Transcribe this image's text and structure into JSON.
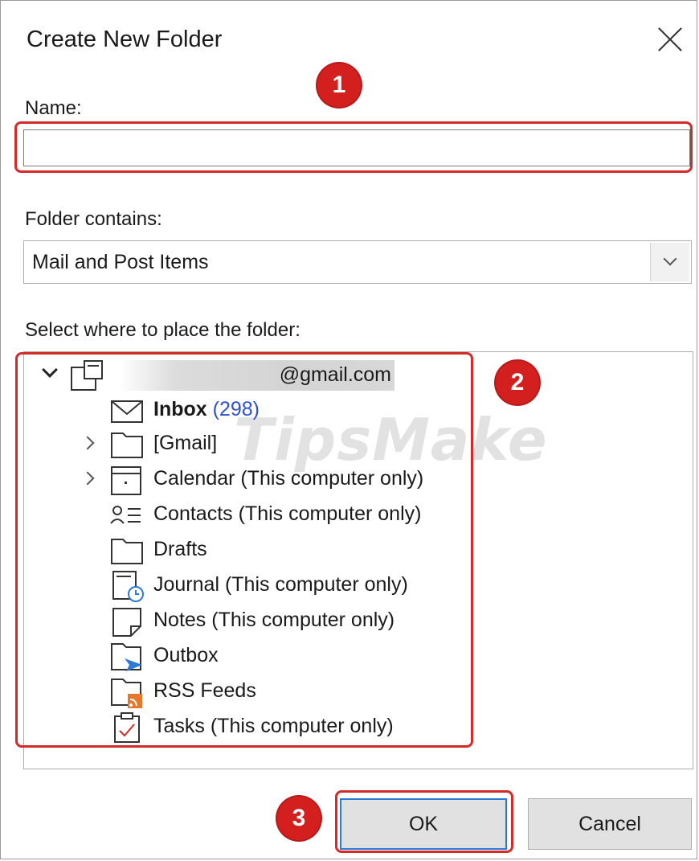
{
  "dialog": {
    "title": "Create New Folder",
    "close_icon": "close-icon"
  },
  "name_field": {
    "label": "Name:",
    "value": "",
    "placeholder": ""
  },
  "folder_contains": {
    "label": "Folder contains:",
    "selected": "Mail and Post Items"
  },
  "location": {
    "label": "Select where to place the folder:",
    "account": "@gmail.com",
    "folders": [
      {
        "name": "Inbox",
        "count": "(298)",
        "icon": "mail-icon"
      },
      {
        "name": "[Gmail]",
        "icon": "folder-icon"
      },
      {
        "name": "Calendar (This computer only)",
        "icon": "calendar-icon"
      },
      {
        "name": "Contacts (This computer only)",
        "icon": "contacts-icon"
      },
      {
        "name": "Drafts",
        "icon": "folder-icon"
      },
      {
        "name": "Journal (This computer only)",
        "icon": "journal-icon"
      },
      {
        "name": "Notes (This computer only)",
        "icon": "notes-icon"
      },
      {
        "name": "Outbox",
        "icon": "outbox-icon"
      },
      {
        "name": "RSS Feeds",
        "icon": "rss-icon"
      },
      {
        "name": "Tasks (This computer only)",
        "icon": "tasks-icon"
      }
    ]
  },
  "buttons": {
    "ok": "OK",
    "cancel": "Cancel"
  },
  "annotations": {
    "step1": "1",
    "step2": "2",
    "step3": "3",
    "color": "#d42a2a"
  },
  "watermark": "TipsMake"
}
